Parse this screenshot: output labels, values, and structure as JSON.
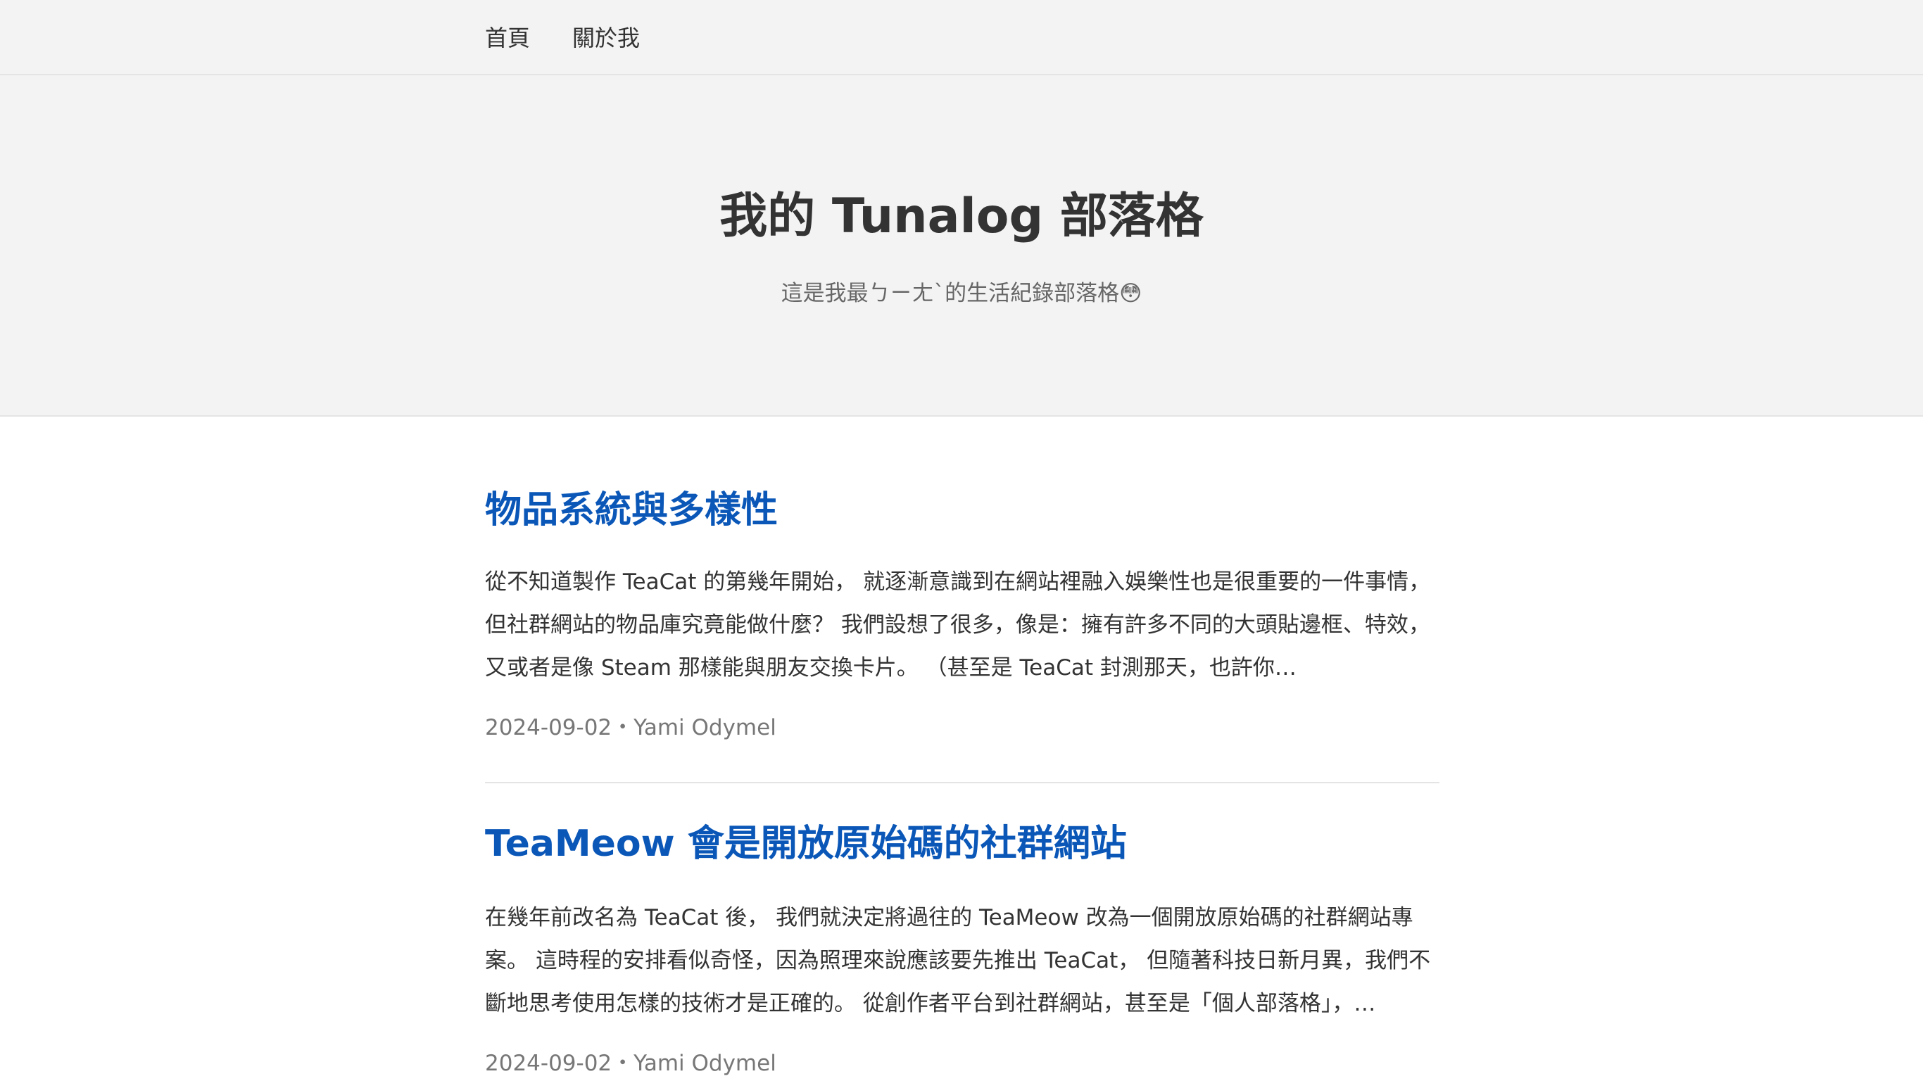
{
  "nav": {
    "items": [
      {
        "label": "首頁"
      },
      {
        "label": "關於我"
      }
    ]
  },
  "hero": {
    "title": "我的 Tunalog 部落格",
    "subtitle": "這是我最ㄅㄧㄤˋ的生活紀錄部落格",
    "subtitle_emoji": "😳"
  },
  "posts": [
    {
      "title": "物品系統與多樣性",
      "excerpt": "從不知道製作 TeaCat 的第幾年開始， 就逐漸意識到在網站裡融入娛樂性也是很重要的一件事情， 但社群網站的物品庫究竟能做什麼？ 我們設想了很多，像是：擁有許多不同的大頭貼邊框、特效， 又或者是像 Steam 那樣能與朋友交換卡片。 （甚至是 TeaCat 封測那天，也許你…",
      "date": "2024-09-02",
      "separator": "・",
      "author": "Yami Odymel"
    },
    {
      "title": "TeaMeow 會是開放原始碼的社群網站",
      "excerpt": "在幾年前改名為 TeaCat 後， 我們就決定將過往的 TeaMeow 改為一個開放原始碼的社群網站專案。 這時程的安排看似奇怪，因為照理來說應該要先推出 TeaCat， 但隨著科技日新月異，我們不斷地思考使用怎樣的技術才是正確的。 從創作者平台到社群網站，甚至是「個人部落格」，…",
      "date": "2024-09-02",
      "separator": "・",
      "author": "Yami Odymel"
    }
  ]
}
